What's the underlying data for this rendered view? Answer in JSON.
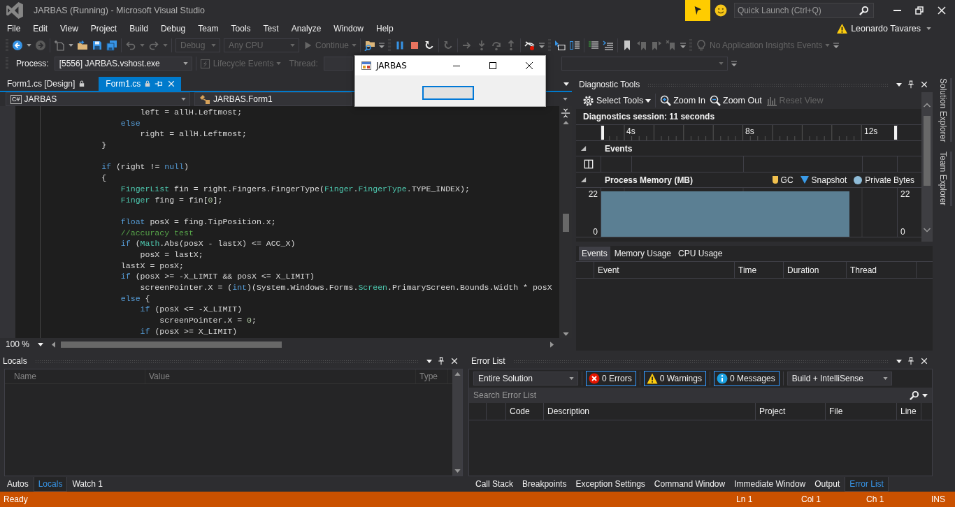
{
  "window": {
    "title": "JARBAS (Running) - Microsoft Visual Studio"
  },
  "quick_launch": {
    "placeholder": "Quick Launch (Ctrl+Q)"
  },
  "menu": [
    "File",
    "Edit",
    "View",
    "Project",
    "Build",
    "Debug",
    "Team",
    "Tools",
    "Test",
    "Analyze",
    "Window",
    "Help"
  ],
  "account": {
    "name": "Leonardo Tavares"
  },
  "toolbar": {
    "configuration": {
      "value": "Debug",
      "disabled": true
    },
    "platform": {
      "value": "Any CPU",
      "disabled": true
    },
    "continue": {
      "label": "Continue",
      "disabled": true
    },
    "insights": {
      "label": "No Application Insights Events",
      "disabled": true
    }
  },
  "debug_location": {
    "process_label": "Process:",
    "process": "[5556] JARBAS.vshost.exe",
    "lifecycle": {
      "label": "Lifecycle Events",
      "disabled": true
    },
    "thread_label": "Thread:"
  },
  "app_window": {
    "title": "JARBAS"
  },
  "editor": {
    "tabs": [
      {
        "label": "Form1.cs [Design]",
        "selected": false
      },
      {
        "label": "Form1.cs",
        "selected": true
      }
    ],
    "language_badge": "C#",
    "project": "JARBAS",
    "class": "JARBAS.Form1",
    "zoom": "100 %",
    "lines": [
      {
        "kind": "code",
        "tokens": [
          {
            "kind": "plain",
            "text": "                    left = allH.Leftmost;"
          }
        ]
      },
      {
        "kind": "code",
        "tokens": [
          {
            "kind": "keyword",
            "text": "                else"
          }
        ]
      },
      {
        "kind": "code",
        "tokens": [
          {
            "kind": "plain",
            "text": "                    right = allH.Leftmost;"
          }
        ]
      },
      {
        "kind": "code",
        "tokens": [
          {
            "kind": "plain",
            "text": "            }"
          }
        ]
      },
      {
        "kind": "blank"
      },
      {
        "kind": "code",
        "tokens": [
          {
            "kind": "keyword",
            "text": "            if"
          },
          {
            "kind": "plain",
            "text": " (right != "
          },
          {
            "kind": "keyword",
            "text": "null"
          },
          {
            "kind": "plain",
            "text": ")"
          }
        ]
      },
      {
        "kind": "code",
        "tokens": [
          {
            "kind": "plain",
            "text": "            {"
          }
        ]
      },
      {
        "kind": "code",
        "tokens": [
          {
            "kind": "type",
            "text": "                FingerList"
          },
          {
            "kind": "plain",
            "text": " fin = right.Fingers.FingerType("
          },
          {
            "kind": "type",
            "text": "Finger"
          },
          {
            "kind": "plain",
            "text": "."
          },
          {
            "kind": "type",
            "text": "FingerType"
          },
          {
            "kind": "plain",
            "text": ".TYPE_INDEX);"
          }
        ]
      },
      {
        "kind": "code",
        "tokens": [
          {
            "kind": "type",
            "text": "                Finger"
          },
          {
            "kind": "plain",
            "text": " fing = fin["
          },
          {
            "kind": "number",
            "text": "0"
          },
          {
            "kind": "plain",
            "text": "];"
          }
        ]
      },
      {
        "kind": "blank"
      },
      {
        "kind": "code",
        "tokens": [
          {
            "kind": "keyword",
            "text": "                float"
          },
          {
            "kind": "plain",
            "text": " posX = fing.TipPosition.x;"
          }
        ]
      },
      {
        "kind": "code",
        "tokens": [
          {
            "kind": "comment",
            "text": "                //accuracy test"
          }
        ]
      },
      {
        "kind": "code",
        "tokens": [
          {
            "kind": "keyword",
            "text": "                if"
          },
          {
            "kind": "plain",
            "text": " ("
          },
          {
            "kind": "type",
            "text": "Math"
          },
          {
            "kind": "plain",
            "text": ".Abs(posX - lastX) <= ACC_X)"
          }
        ]
      },
      {
        "kind": "code",
        "tokens": [
          {
            "kind": "plain",
            "text": "                    posX = lastX;"
          }
        ]
      },
      {
        "kind": "code",
        "tokens": [
          {
            "kind": "plain",
            "text": "                lastX = posX;"
          }
        ]
      },
      {
        "kind": "code",
        "tokens": [
          {
            "kind": "keyword",
            "text": "                if"
          },
          {
            "kind": "plain",
            "text": " (posX >= -X_LIMIT && posX <= X_LIMIT)"
          }
        ]
      },
      {
        "kind": "code",
        "tokens": [
          {
            "kind": "plain",
            "text": "                    screenPointer.X = ("
          },
          {
            "kind": "keyword",
            "text": "int"
          },
          {
            "kind": "plain",
            "text": ")(System.Windows.Forms."
          },
          {
            "kind": "type",
            "text": "Screen"
          },
          {
            "kind": "plain",
            "text": ".PrimaryScreen.Bounds.Width * posX"
          }
        ]
      },
      {
        "kind": "code",
        "tokens": [
          {
            "kind": "keyword",
            "text": "                else"
          },
          {
            "kind": "plain",
            "text": " {"
          }
        ]
      },
      {
        "kind": "code",
        "tokens": [
          {
            "kind": "keyword",
            "text": "                    if"
          },
          {
            "kind": "plain",
            "text": " (posX <= -X_LIMIT)"
          }
        ]
      },
      {
        "kind": "code",
        "tokens": [
          {
            "kind": "plain",
            "text": "                        screenPointer.X = "
          },
          {
            "kind": "number",
            "text": "0"
          },
          {
            "kind": "plain",
            "text": ";"
          }
        ]
      },
      {
        "kind": "code",
        "tokens": [
          {
            "kind": "keyword",
            "text": "                    if"
          },
          {
            "kind": "plain",
            "text": " (posX >= X_LIMIT)"
          }
        ]
      }
    ]
  },
  "diagnostics": {
    "title": "Diagnostic Tools",
    "tools": [
      {
        "label": "Select Tools",
        "kind": "gear",
        "disabled": false
      },
      {
        "label": "Zoom In",
        "kind": "zoom-in",
        "disabled": false
      },
      {
        "label": "Zoom Out",
        "kind": "zoom-out",
        "disabled": false
      },
      {
        "label": "Reset View",
        "kind": "reset",
        "disabled": true
      }
    ],
    "session": "Diagnostics session: 11 seconds",
    "ruler": [
      "4s",
      "8s",
      "12s"
    ],
    "events_heading": "Events",
    "memory_heading": "Process Memory (MB)",
    "legend": [
      {
        "label": "GC",
        "kind": "gc",
        "color": "#f2c14e"
      },
      {
        "label": "Snapshot",
        "kind": "snapshot",
        "color": "#3a9be8"
      },
      {
        "label": "Private Bytes",
        "kind": "private-bytes",
        "color": "#8fbcd8"
      }
    ],
    "memory_chart": {
      "left_axis": [
        "22",
        "0"
      ],
      "right_axis": [
        "22",
        "0"
      ]
    },
    "tabs": [
      {
        "label": "Events",
        "selected": true
      },
      {
        "label": "Memory Usage",
        "selected": false
      },
      {
        "label": "CPU Usage",
        "selected": false
      }
    ],
    "columns": [
      "Event",
      "Time",
      "Duration",
      "Thread"
    ]
  },
  "side_tabs": [
    "Solution Explorer",
    "Team Explorer"
  ],
  "locals": {
    "title": "Locals",
    "columns": [
      "Name",
      "Value",
      "Type"
    ],
    "tabs": [
      {
        "label": "Autos",
        "selected": false
      },
      {
        "label": "Locals",
        "selected": true
      },
      {
        "label": "Watch 1",
        "selected": false
      }
    ]
  },
  "error_list": {
    "title": "Error List",
    "scope": "Entire Solution",
    "filters": [
      {
        "label": "0 Errors",
        "kind": "error",
        "on": true
      },
      {
        "label": "0 Warnings",
        "kind": "warning",
        "on": true
      },
      {
        "label": "0 Messages",
        "kind": "info",
        "on": true
      }
    ],
    "source": "Build + IntelliSense",
    "search": {
      "placeholder": "Search Error List"
    },
    "columns": [
      "Code",
      "Description",
      "Project",
      "File",
      "Line"
    ],
    "tabs": [
      {
        "label": "Call Stack",
        "selected": false
      },
      {
        "label": "Breakpoints",
        "selected": false
      },
      {
        "label": "Exception Settings",
        "selected": false
      },
      {
        "label": "Command Window",
        "selected": false
      },
      {
        "label": "Immediate Window",
        "selected": false
      },
      {
        "label": "Output",
        "selected": false
      },
      {
        "label": "Error List",
        "selected": true
      }
    ]
  },
  "status_bar": {
    "message": "Ready",
    "line": "Ln 1",
    "column": "Col 1",
    "char": "Ch 1",
    "mode": "INS"
  }
}
